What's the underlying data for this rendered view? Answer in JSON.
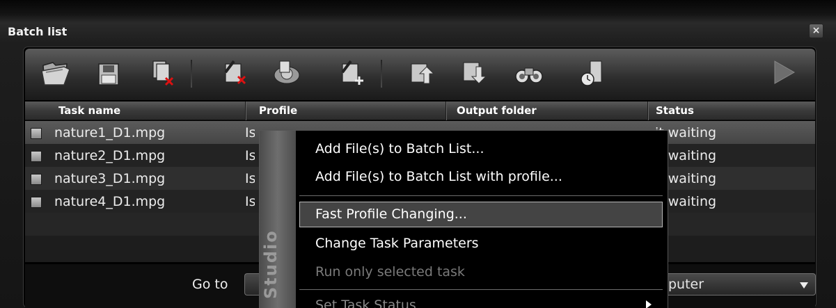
{
  "window": {
    "title": "Batch list",
    "close_label": "×"
  },
  "toolbar": {
    "buttons": [
      {
        "icon": "open-folder-icon"
      },
      {
        "icon": "save-icon"
      },
      {
        "icon": "delete-all-icon"
      },
      {
        "icon": "remove-task-icon"
      },
      {
        "icon": "convert-settings-icon"
      },
      {
        "icon": "add-task-icon"
      },
      {
        "icon": "move-up-icon"
      },
      {
        "icon": "move-down-icon"
      },
      {
        "icon": "binoculars-icon"
      },
      {
        "icon": "scheduler-icon"
      },
      {
        "icon": "play-icon"
      }
    ]
  },
  "table": {
    "columns": [
      "Task name",
      "Profile",
      "Output folder",
      "Status"
    ],
    "rows": [
      {
        "name": "nature1_D1.mpg",
        "profile": "Is",
        "status": "it waiting"
      },
      {
        "name": "nature2_D1.mpg",
        "profile": "Is",
        "status": "it waiting"
      },
      {
        "name": "nature3_D1.mpg",
        "profile": "Is",
        "status": "it waiting"
      },
      {
        "name": "nature4_D1.mpg",
        "profile": "Is",
        "status": "it waiting"
      }
    ]
  },
  "footer": {
    "goto_label": "Go to",
    "destination_value": "puter"
  },
  "context_menu": {
    "brand": "Studio",
    "items": [
      {
        "label": "Add File(s) to Batch List..."
      },
      {
        "label": "Add File(s) to Batch List with profile..."
      },
      {
        "label": "Fast Profile Changing..."
      },
      {
        "label": "Change Task Parameters"
      },
      {
        "label": "Run only selected task"
      },
      {
        "label": "Set Task Status"
      }
    ]
  }
}
